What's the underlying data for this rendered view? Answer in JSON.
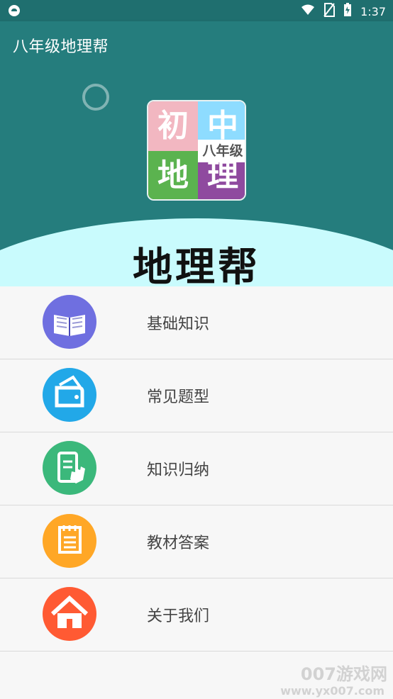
{
  "status_bar": {
    "time": "1:37",
    "icons": [
      "notification-icon",
      "wifi-icon",
      "no-sim-icon",
      "battery-charging-icon"
    ]
  },
  "app": {
    "title": "八年级地理帮"
  },
  "banner": {
    "logo": {
      "top_left": "初",
      "top_right": "中",
      "bottom_left": "地",
      "bottom_right": "理",
      "middle": "八年级"
    },
    "title": "地理帮"
  },
  "menu": {
    "items": [
      {
        "label": "基础知识",
        "icon": "book-icon",
        "color": "#6f6fe0"
      },
      {
        "label": "常见题型",
        "icon": "wallet-icon",
        "color": "#22a8e8"
      },
      {
        "label": "知识归纳",
        "icon": "phone-touch-icon",
        "color": "#3bb87b"
      },
      {
        "label": "教材答案",
        "icon": "notepad-icon",
        "color": "#ffa726"
      },
      {
        "label": "关于我们",
        "icon": "home-icon",
        "color": "#ff5a33"
      }
    ]
  },
  "watermark": {
    "line1": "007游戏网",
    "line2": "www.yx007.com"
  }
}
